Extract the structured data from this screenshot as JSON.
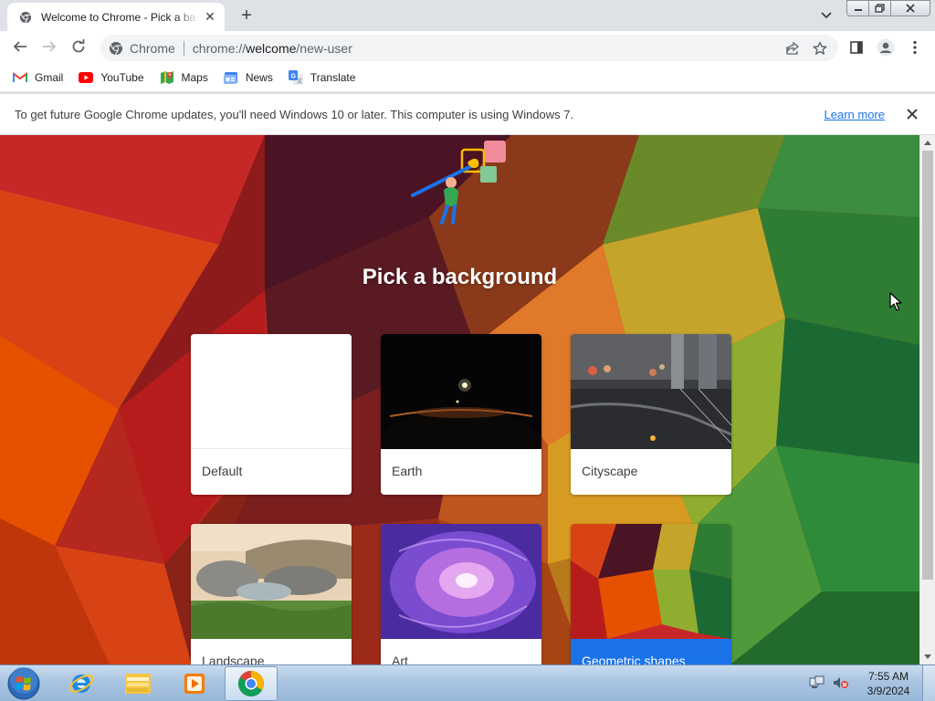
{
  "window": {
    "tab": {
      "title": "Welcome to Chrome - Pick a background",
      "close": "✕"
    },
    "new_tab": "+",
    "controls": [
      "minimize",
      "restore",
      "close"
    ]
  },
  "toolbar": {
    "omnibox": {
      "chip": "Chrome",
      "url_scheme": "chrome://",
      "url_host": "welcome",
      "url_path": "/new-user"
    }
  },
  "bookmarks": [
    {
      "label": "Gmail",
      "icon": "gmail-icon"
    },
    {
      "label": "YouTube",
      "icon": "youtube-icon"
    },
    {
      "label": "Maps",
      "icon": "maps-icon"
    },
    {
      "label": "News",
      "icon": "news-icon"
    },
    {
      "label": "Translate",
      "icon": "translate-icon"
    }
  ],
  "infobar": {
    "message": "To get future Google Chrome updates, you'll need Windows 10 or later. This computer is using Windows 7.",
    "link": "Learn more",
    "close": "✕"
  },
  "page": {
    "title": "Pick a background",
    "backgrounds": [
      {
        "label": "Default",
        "selected": false
      },
      {
        "label": "Earth",
        "selected": false
      },
      {
        "label": "Cityscape",
        "selected": false
      },
      {
        "label": "Landscape",
        "selected": false
      },
      {
        "label": "Art",
        "selected": false
      },
      {
        "label": "Geometric shapes",
        "selected": true
      }
    ]
  },
  "taskbar": {
    "apps": [
      "internet-explorer-icon",
      "file-explorer-icon",
      "media-player-icon",
      "chrome-icon"
    ],
    "active_app": "chrome-icon",
    "clock": {
      "time": "7:55 AM",
      "date": "3/9/2024"
    }
  },
  "colors": {
    "accent": "#1a73e8",
    "infobar_link": "#1a73e8"
  }
}
